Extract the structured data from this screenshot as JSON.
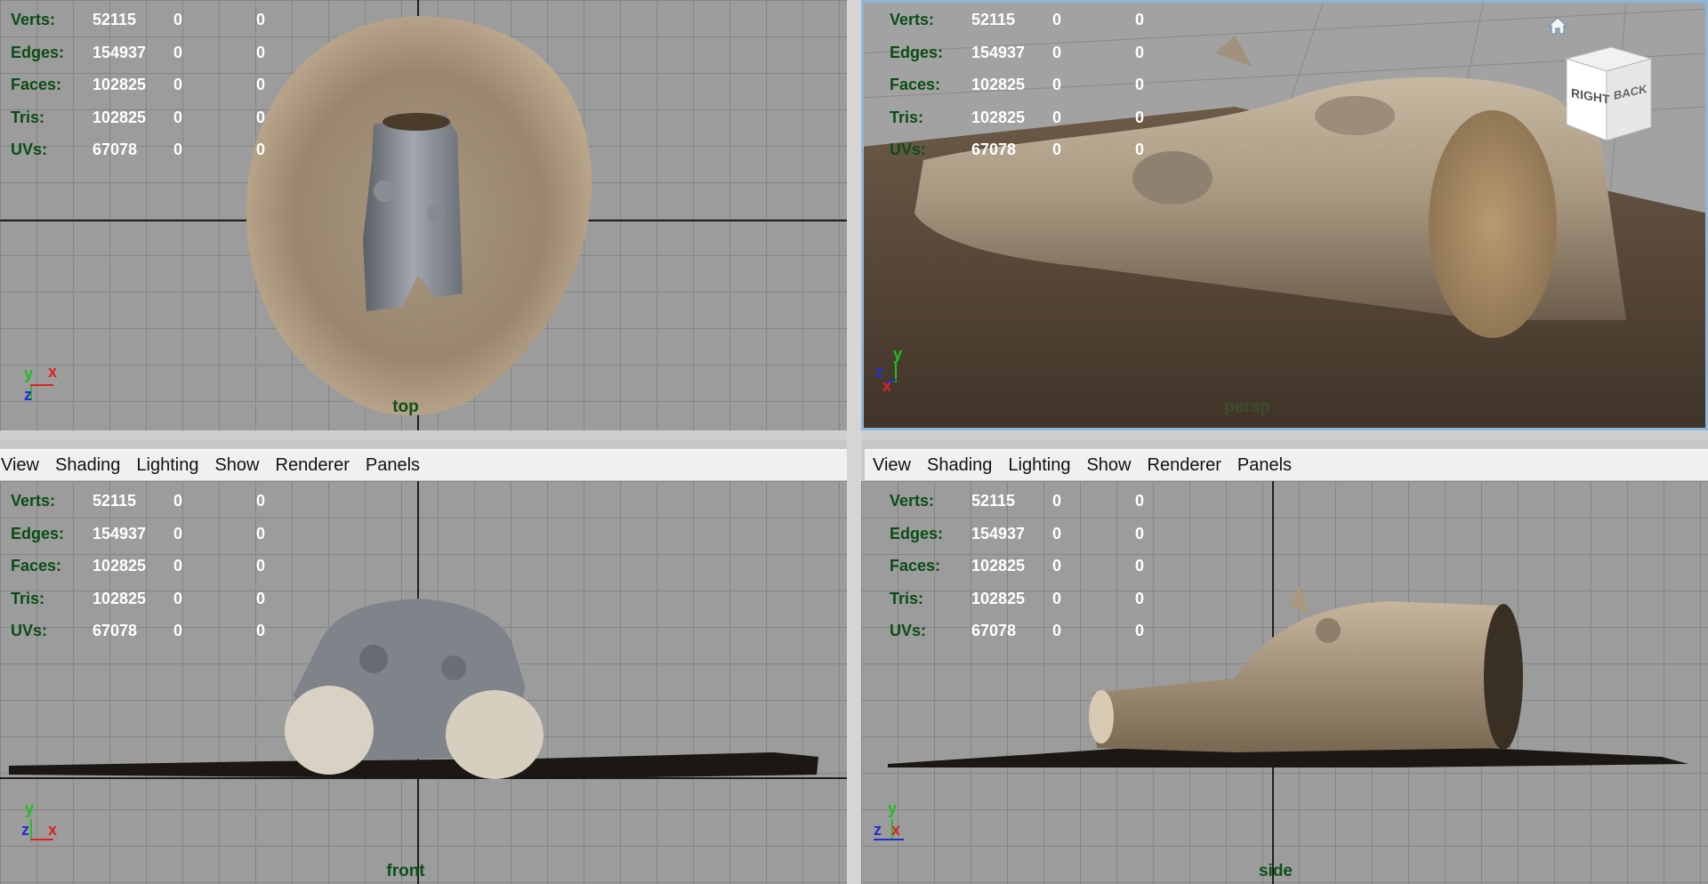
{
  "menu": [
    "View",
    "Shading",
    "Lighting",
    "Show",
    "Renderer",
    "Panels"
  ],
  "stats": [
    {
      "label": "Verts:",
      "value": "52115",
      "sel": "0",
      "comp": "0"
    },
    {
      "label": "Edges:",
      "value": "154937",
      "sel": "0",
      "comp": "0"
    },
    {
      "label": "Faces:",
      "value": "102825",
      "sel": "0",
      "comp": "0"
    },
    {
      "label": "Tris:",
      "value": "102825",
      "sel": "0",
      "comp": "0"
    },
    {
      "label": "UVs:",
      "value": "67078",
      "sel": "0",
      "comp": "0"
    }
  ],
  "views": {
    "top": {
      "label": "top"
    },
    "persp": {
      "label": "persp"
    },
    "front": {
      "label": "front"
    },
    "side": {
      "label": "side"
    }
  },
  "viewcube": {
    "face1": "RIGHT",
    "face2": "BACK"
  },
  "gizmos": {
    "top": {
      "a": "y",
      "b": "x",
      "c": "z"
    },
    "persp": {
      "a": "y",
      "b": "z",
      "c": "x"
    },
    "front": {
      "a": "y",
      "b": "z",
      "c": "x"
    },
    "side": {
      "a": "y",
      "b": "z",
      "c": "x"
    }
  },
  "colors": {
    "accent_green": "#0a4d14",
    "axis_red": "#e02020",
    "axis_blue": "#2030d0",
    "axis_green": "#20c020"
  }
}
